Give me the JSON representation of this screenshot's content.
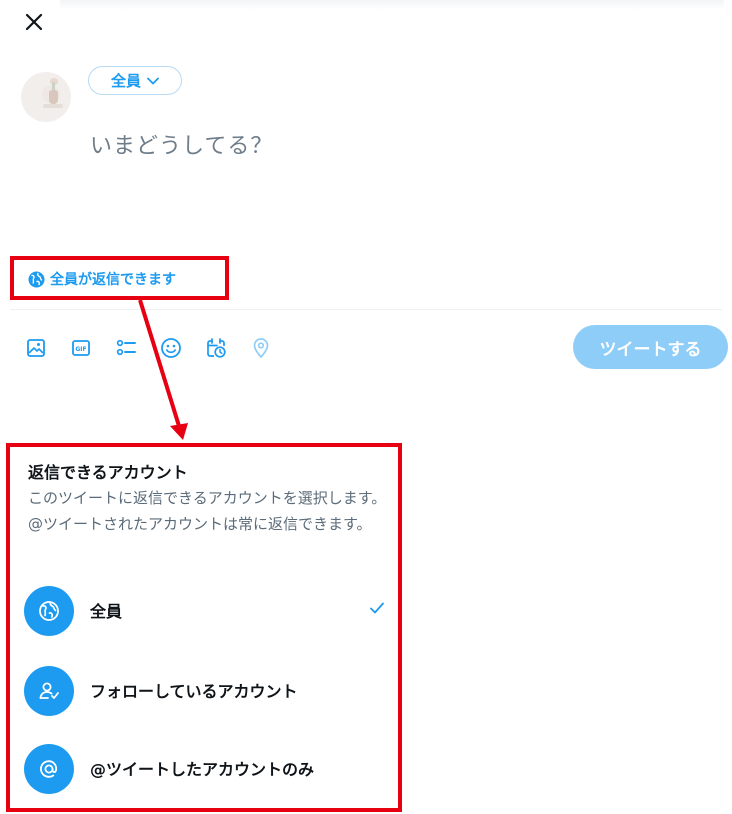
{
  "compose": {
    "audience_label": "全員",
    "placeholder": "いまどうしてる？",
    "reply_setting": "全員が返信できます",
    "tweet_button": "ツイートする"
  },
  "toolbar": {
    "icons": [
      "image-icon",
      "gif-icon",
      "poll-icon",
      "emoji-icon",
      "schedule-icon",
      "location-icon"
    ]
  },
  "reply_panel": {
    "title": "返信できるアカウント",
    "description": "このツイートに返信できるアカウントを選択します。@ツイートされたアカウントは常に返信できます。",
    "options": [
      {
        "label": "全員",
        "icon": "globe-icon",
        "selected": true
      },
      {
        "label": "フォローしているアカウント",
        "icon": "person-check-icon",
        "selected": false
      },
      {
        "label": "@ツイートしたアカウントのみ",
        "icon": "at-icon",
        "selected": false
      }
    ]
  },
  "colors": {
    "accent": "#1d9bf0",
    "accent_disabled": "#8ecdf8",
    "highlight": "#e60012",
    "placeholder_text": "#6f7d8a"
  }
}
